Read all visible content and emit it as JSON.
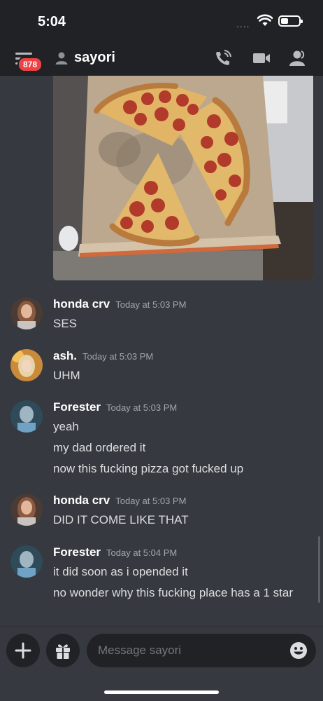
{
  "status_bar": {
    "time": "5:04",
    "signal": "....",
    "wifi_icon": "wifi-icon",
    "battery_icon": "battery-icon"
  },
  "header": {
    "unread_badge": "878",
    "dm_name": "sayori",
    "icons": [
      "menu-icon",
      "user-icon",
      "phone-call-icon",
      "video-camera-icon",
      "member-list-icon"
    ]
  },
  "attachment": {
    "type": "image",
    "icon": "pizza-photo"
  },
  "messages": [
    {
      "author": "honda crv",
      "timestamp": "Today at 5:03 PM",
      "lines": [
        "SES"
      ],
      "avatar_color": "#a36d55"
    },
    {
      "author": "ash.",
      "timestamp": "Today at 5:03 PM",
      "lines": [
        "UHM"
      ],
      "avatar_color": "#d9a441"
    },
    {
      "author": "Forester",
      "timestamp": "Today at 5:03 PM",
      "lines": [
        "yeah",
        "my dad ordered it",
        "now this fucking pizza got fucked up"
      ],
      "avatar_color": "#4d6b7a"
    },
    {
      "author": "honda crv",
      "timestamp": "Today at 5:03 PM",
      "lines": [
        "DID IT COME LIKE THAT"
      ],
      "avatar_color": "#a36d55"
    },
    {
      "author": "Forester",
      "timestamp": "Today at 5:04 PM",
      "lines": [
        "it did soon as i opended it",
        "no wonder why this fucking place has a 1 star"
      ],
      "avatar_color": "#4d6b7a"
    }
  ],
  "composer": {
    "placeholder": "Message sayori",
    "plus_icon": "plus-icon",
    "gift_icon": "gift-icon",
    "emoji_icon": "emoji-icon"
  },
  "colors": {
    "background": "#36393f",
    "bar": "#202225",
    "badge": "#ed4245",
    "text": "#dcddde",
    "muted": "#a3a6aa"
  }
}
